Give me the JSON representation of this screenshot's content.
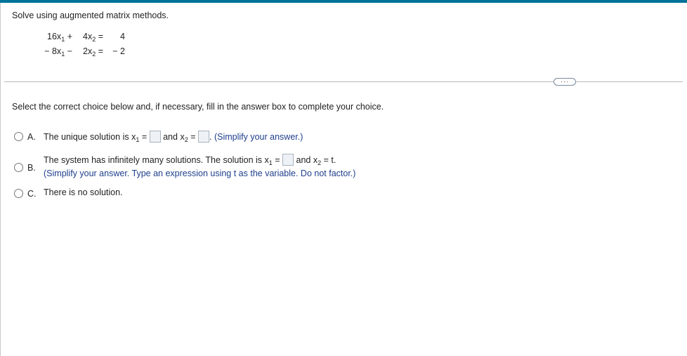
{
  "question": {
    "prompt": "Solve using augmented matrix methods.",
    "equations": [
      {
        "term1": "16x",
        "term1_sub": "1",
        "op": "+",
        "term2": "4x",
        "term2_sub": "2",
        "equals": "=",
        "rhs": "4"
      },
      {
        "term1": "− 8x",
        "term1_sub": "1",
        "op": "−",
        "term2": "2x",
        "term2_sub": "2",
        "equals": "=",
        "rhs": "− 2"
      }
    ]
  },
  "more_button_label": "···",
  "instruction": "Select the correct choice below and, if necessary, fill in the answer box to complete your choice.",
  "choices": {
    "a": {
      "letter": "A.",
      "text_before": "The unique solution is x",
      "var1_sub": "1",
      "equals": " =",
      "text_middle": "and x",
      "var2_sub": "2",
      "equals2": " =",
      "period": ".",
      "hint": "(Simplify your answer.)"
    },
    "b": {
      "letter": "B.",
      "text_before": "The system has infinitely many solutions. The solution is x",
      "var1_sub": "1",
      "equals": " =",
      "text_middle": "and x",
      "var2_sub": "2",
      "text_after": " = t.",
      "hint": "(Simplify your answer. Type an expression using t as the variable. Do not factor.)"
    },
    "c": {
      "letter": "C.",
      "text": "There is no solution."
    }
  },
  "colors": {
    "top_bar": "#00739a",
    "hint_text": "#1f3f8c"
  }
}
